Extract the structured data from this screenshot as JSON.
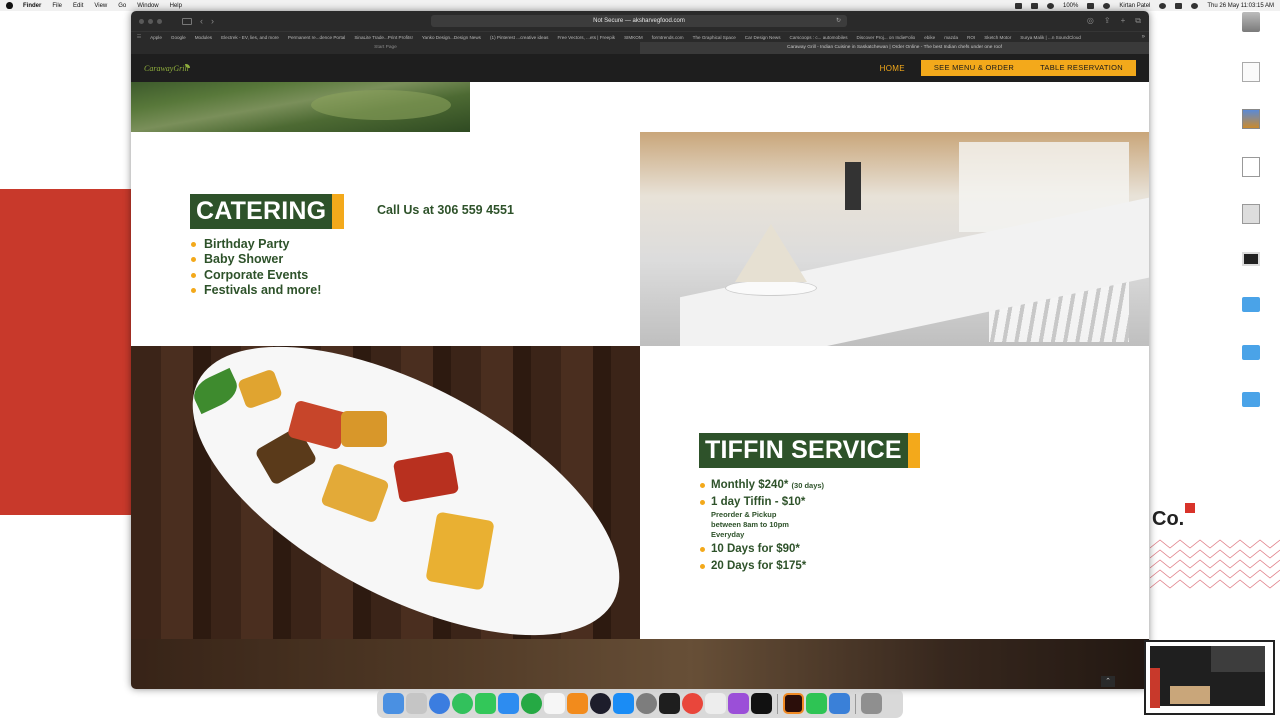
{
  "menubar": {
    "app_name": "Finder",
    "menus": [
      "File",
      "Edit",
      "View",
      "Go",
      "Window",
      "Help"
    ],
    "battery": "100%",
    "user": "Kirtan Patel",
    "datetime": "Thu 26 May  11:03:15 AM"
  },
  "browser": {
    "address": "Not Secure — aksharvegfood.com",
    "bookmarks": [
      "Apple",
      "Google",
      "Modules",
      "Electrek - EV, lies, and more",
      "Permanent re...dence Portal",
      "SinaLite Trade...Print Profits!",
      "Yanko Design...Design News",
      "(1) Pinterest ...creative ideas",
      "Free Vectors, ...ets | Freepik",
      "SIMKOM",
      "formtrends.com",
      "The Graphical Space",
      "Car Design News",
      "Carscoops : c... automobiles",
      "Discover Proj... on IndieFolio",
      "ebike",
      "mazda",
      "ROI",
      "Sketch Motor",
      "Surya Malik | ...n SoundCloud"
    ],
    "tabs": [
      {
        "label": "Start Page",
        "active": false
      },
      {
        "label": "Caraway Grill - Indian Cuisine in Saskatchewan | Order Online - The best Indian chefs under one roof",
        "active": true
      }
    ]
  },
  "site": {
    "logo": "CarawayGrill",
    "nav": {
      "home": "HOME",
      "menu_order": "SEE MENU & ORDER",
      "reservation": "TABLE RESERVATION"
    },
    "catering": {
      "title": "CATERING",
      "call": "Call Us at 306 559 4551",
      "items": [
        "Birthday Party",
        "Baby Shower",
        "Corporate Events",
        "Festivals and more!"
      ]
    },
    "tiffin": {
      "title": "TIFFIN SERVICE",
      "monthly": "Monthly $240*",
      "monthly_note": "(30 days)",
      "one_day": "1 day Tiffin - $10*",
      "one_day_note1": "Preorder & Pickup",
      "one_day_note2": "between 8am to 10pm",
      "one_day_note3": "Everyday",
      "ten_days": "10 Days for $90*",
      "twenty_days": "20 Days for $175*"
    },
    "colors": {
      "green": "#2e522a",
      "orange": "#f3a91b",
      "nav_bg": "#1e1e1e"
    }
  },
  "desktop": {
    "logo_text": "Co."
  },
  "dock": {
    "apps": [
      "finder-icon",
      "launchpad-icon",
      "safari-icon",
      "whatsapp-icon",
      "messages-icon",
      "mail-icon",
      "whatsapp-business-icon",
      "notes-icon",
      "books-icon",
      "davinci-icon",
      "app-store-icon",
      "system-preferences-icon",
      "terminal-icon",
      "chrome-icon",
      "textedit-icon",
      "podcasts-icon",
      "apple-tv-icon",
      "illustrator-icon",
      "facetime-icon",
      "archive-icon",
      "trash-icon"
    ]
  }
}
